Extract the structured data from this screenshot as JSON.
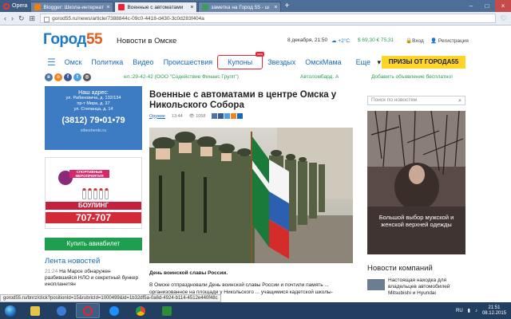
{
  "browser": {
    "menu_label": "Opera",
    "tabs": [
      {
        "title": "Blogger: Школа-интернат",
        "active": false,
        "favicon_color": "#f57d00"
      },
      {
        "title": "Военные с автоматами",
        "active": true,
        "favicon_color": "#e23"
      },
      {
        "title": "заметка на Город 55 - ш",
        "active": false,
        "favicon_color": "#3a9d5d"
      }
    ],
    "address": "gorod55.ru/news/article/7388844c-09c0-4418-d430-3c0d283f404a",
    "status_url": "gorod55.ru/bnrz/click?positionId=15&rubricId=1000499&id=1b32df5a-0a6d-4924-b114-4512e440f48c"
  },
  "site": {
    "logo_main": "Город",
    "logo_num": "55",
    "tagline": "Новости в Омске",
    "date_time": "8 декабря, 21:50",
    "weather": "+2°C",
    "rates": "$ 69,30  € 75,31",
    "login": "Вход",
    "register": "Регистрация",
    "menu": [
      "Омск",
      "Политика",
      "Видео",
      "Происшествия",
      "Купоны",
      "Звездых",
      "ОмскМама",
      "Еще"
    ],
    "coupon_badge": "new",
    "prizes_button": "ПРИЗЫ ОТ ГОРОДА55",
    "ad_line": "ел.:29-42-42 (ООО \"Содействие Финанс Групп\")",
    "ad_line2": "Автоломбард. А",
    "add_ad": "Добавить объявление бесплатно!"
  },
  "sidebar": {
    "address_box": {
      "title": "Наш адрес:",
      "lines": [
        "ул. Рабиновича, д. 132/134",
        "пр-т Мира, д. 37",
        "ул. Степанца, д. 14"
      ],
      "phone": "(3812) 79•01•79",
      "site": "sibeshenki.ru"
    },
    "bowling": {
      "sport": "СПОРТИВНЫЕ МЕРОПРИЯТИЯ",
      "title": "БОУЛИНГ",
      "phone": "707-707"
    },
    "avia_button": "Купить авиабилет",
    "news_feed_title": "Лента новостей",
    "news": [
      {
        "time": "21:24",
        "text": "На Марсе обнаружен разбившийся НЛО и секретный бункер инопланетян"
      }
    ]
  },
  "article": {
    "title": "Военные с автоматами в центре Омска у Никольского Собора",
    "category": "Оружие",
    "time": "13:44",
    "views": "1058",
    "caption": "День воинской славы России.",
    "body": "В Омске отпраздновали День воинской славы России и почтили память ... организованное на площади у Никольского ... учащимися кадетской школы-интерната"
  },
  "right": {
    "search_placeholder": "Поиск по новостям",
    "ad_text": "Большой выбор мужской и женской верхней одежды",
    "company_news_title": "Новости компаний",
    "company_item": "Настоящая находка для владельцев автомобилей Mitsubishi и Hyundai"
  },
  "taskbar": {
    "lang": "RU",
    "time": "21:51",
    "date": "08.12.2015"
  },
  "colors": {
    "accent": "#1a7ac8",
    "prizes": "#ffd429",
    "avia": "#1e9e4f"
  }
}
